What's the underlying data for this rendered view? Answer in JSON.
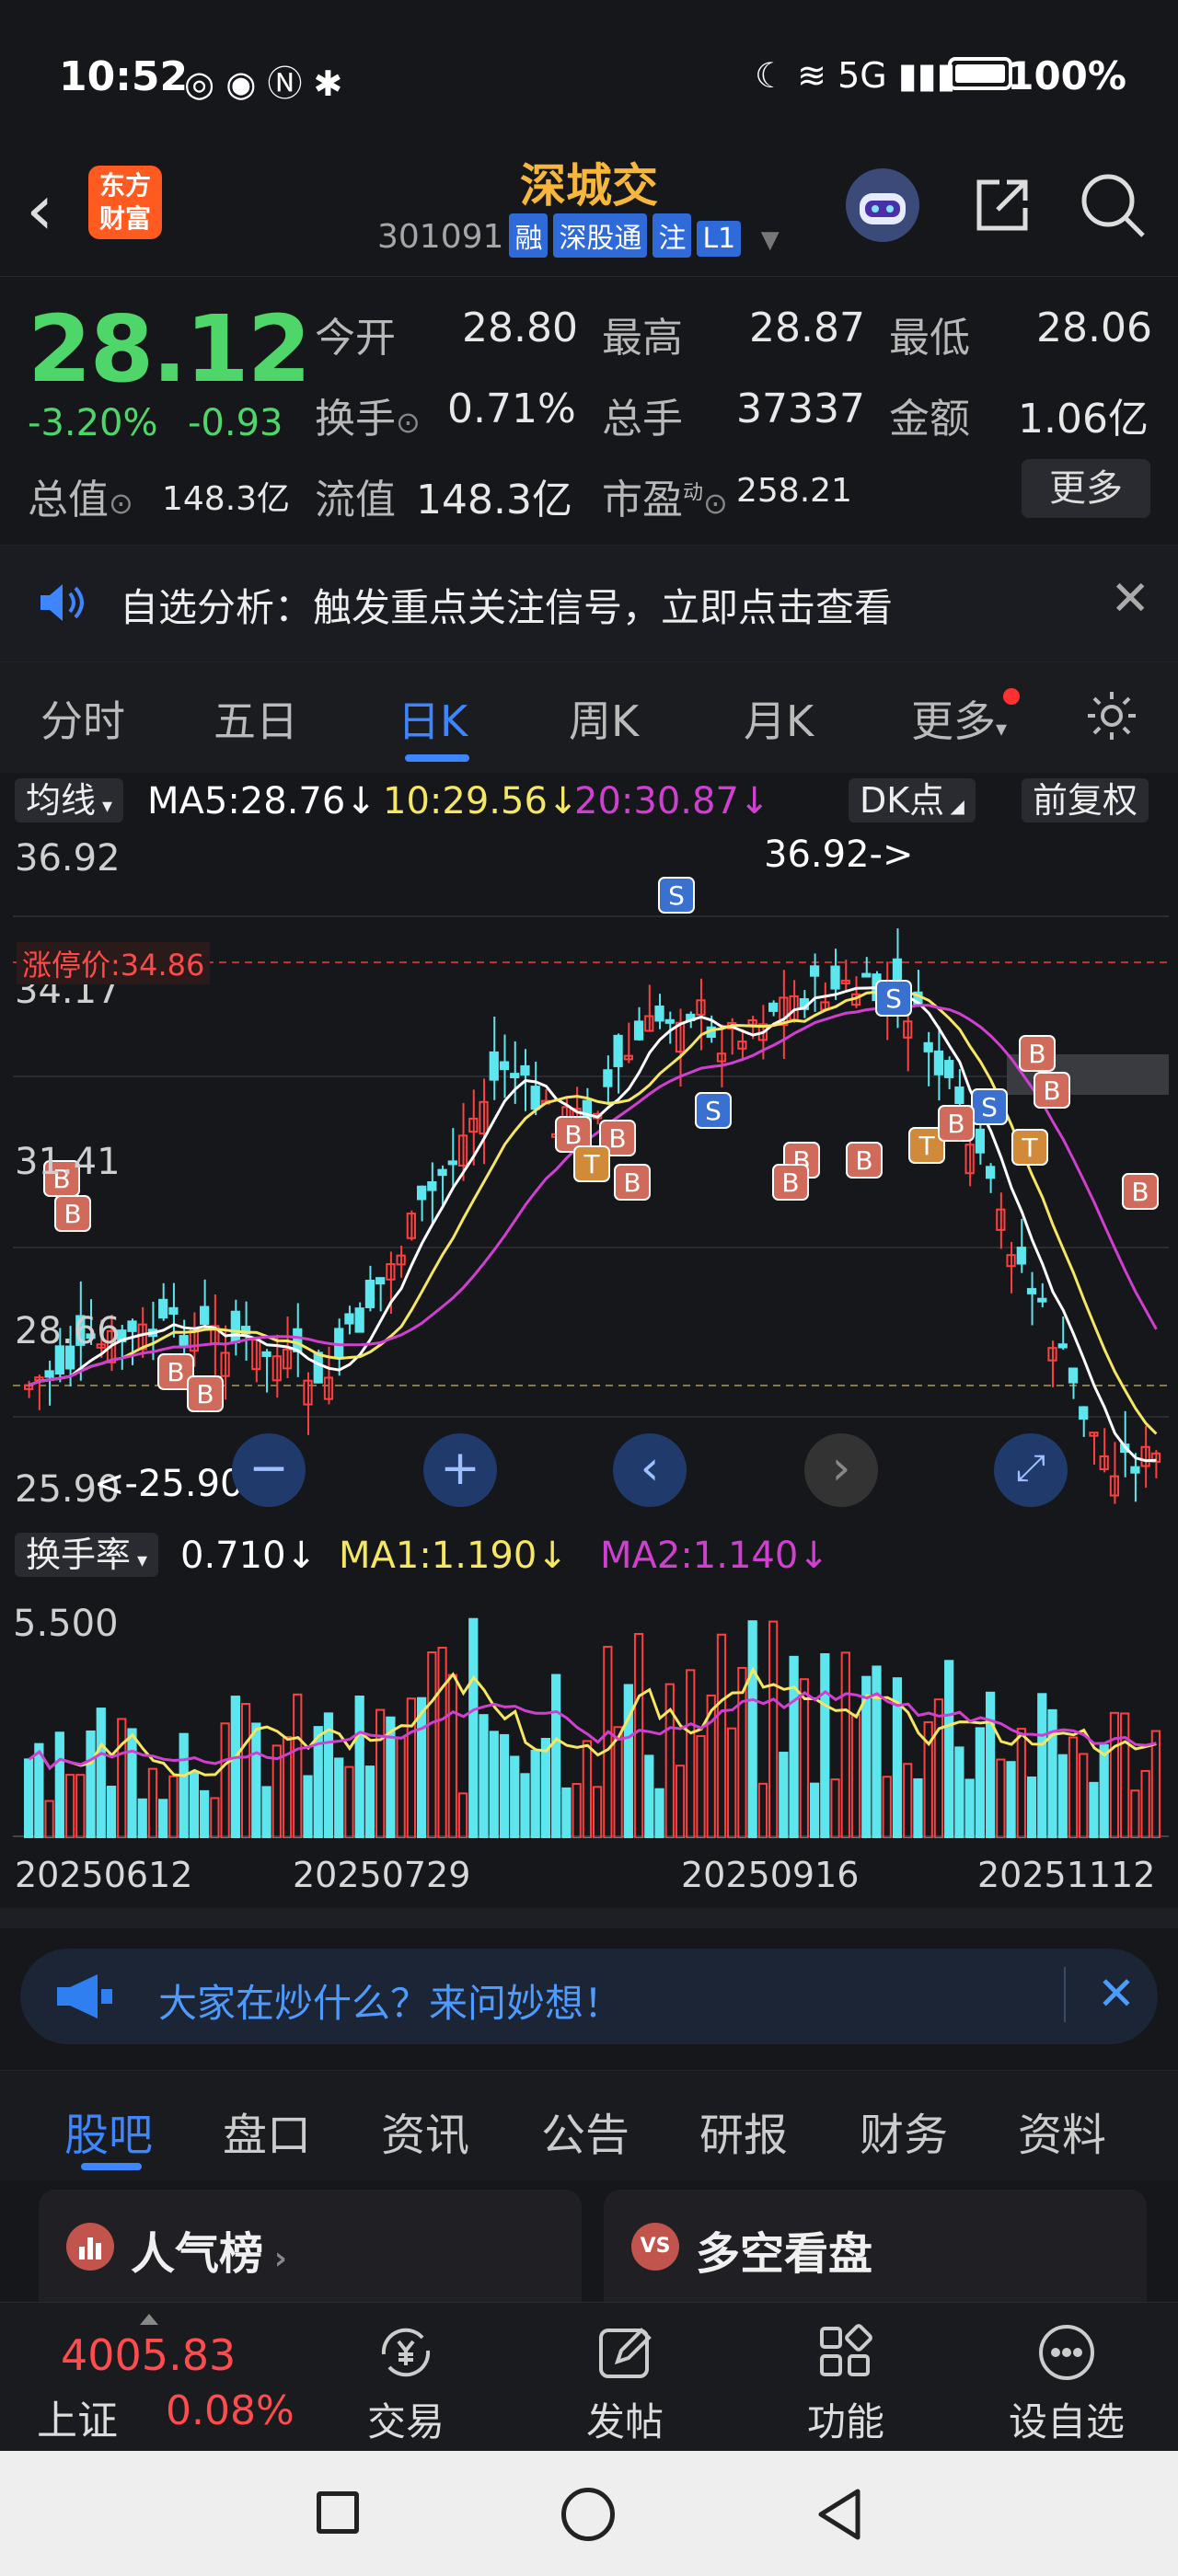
{
  "status": {
    "time": "10:52",
    "network": "5G",
    "battery": "100%"
  },
  "header": {
    "title": "深城交",
    "code": "301091",
    "tags": [
      "融",
      "深股通",
      "注",
      "L1"
    ],
    "logo_line1": "东方",
    "logo_line2": "财富"
  },
  "quote": {
    "price": "28.12",
    "pct": "-3.20%",
    "chg": "-0.93",
    "rows": [
      [
        {
          "label": "今开",
          "value": "28.80",
          "tone": "green"
        },
        {
          "label": "最高",
          "value": "28.87",
          "tone": "green"
        },
        {
          "label": "最低",
          "value": "28.06",
          "tone": "green"
        }
      ],
      [
        {
          "label": "换手",
          "value": "0.71%",
          "tone": "white"
        },
        {
          "label": "总手",
          "value": "37337",
          "tone": "white"
        },
        {
          "label": "金额",
          "value": "1.06亿",
          "tone": "white"
        }
      ]
    ],
    "total_value_label": "总值",
    "total_value": "148.3亿",
    "float_value_label": "流值",
    "float_value": "148.3亿",
    "pe_label": "市盈",
    "pe_super": "动",
    "pe_value": "258.21",
    "more": "更多"
  },
  "notice": {
    "text": "自选分析：触发重点关注信号，立即点击查看"
  },
  "ktabs": [
    "分时",
    "五日",
    "日K",
    "周K",
    "月K",
    "更多"
  ],
  "mabar": {
    "ma_btn": "均线",
    "ma5": "MA5:28.76",
    "ma10": "10:29.56",
    "ma20": "20:30.87",
    "dk": "DK点",
    "adj": "前复权",
    "colors": {
      "ma5": "#ffffff",
      "ma10": "#f5e663",
      "ma20": "#d040d0"
    }
  },
  "chart": {
    "y_labels": [
      "36.92",
      "34.17",
      "31.41",
      "28.66",
      "25.90"
    ],
    "limit_up": "涨停价:34.86",
    "high_mark": "36.92->",
    "low_mark": "<-25.90",
    "signals": {
      "B": "B",
      "S": "S",
      "T": "T"
    }
  },
  "turnover": {
    "btn": "换手率",
    "value": "0.710",
    "ma1": "MA1:1.190",
    "ma2": "MA2:1.140",
    "y_label": "5.500",
    "x_labels": [
      "20250612",
      "20250729",
      "20250916",
      "20251112"
    ]
  },
  "ask": {
    "text": "大家在炒什么？来问妙想！"
  },
  "btabs": [
    "股吧",
    "盘口",
    "资讯",
    "公告",
    "研报",
    "财务",
    "资料"
  ],
  "cards": [
    "人气榜",
    "多空看盘"
  ],
  "bottomnav": {
    "index_value": "4005.83",
    "index_name": "上证",
    "index_pct": "0.08%",
    "items": [
      "交易",
      "发帖",
      "功能",
      "设自选"
    ]
  }
}
